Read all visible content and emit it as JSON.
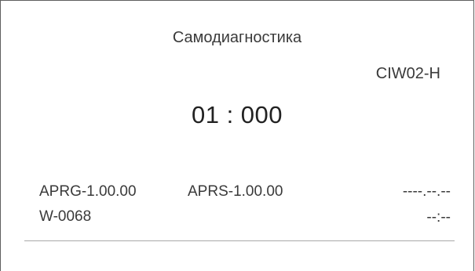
{
  "screen": {
    "title": "Самодиагностика",
    "model": "CIW02-H",
    "diagnostic_code": "01 : 000"
  },
  "versions": {
    "aprg": "APRG-1.00.00",
    "aprs": "APRS-1.00.00",
    "w": "W-0068"
  },
  "datetime": {
    "date": "----.--.--",
    "time": "--:--"
  }
}
